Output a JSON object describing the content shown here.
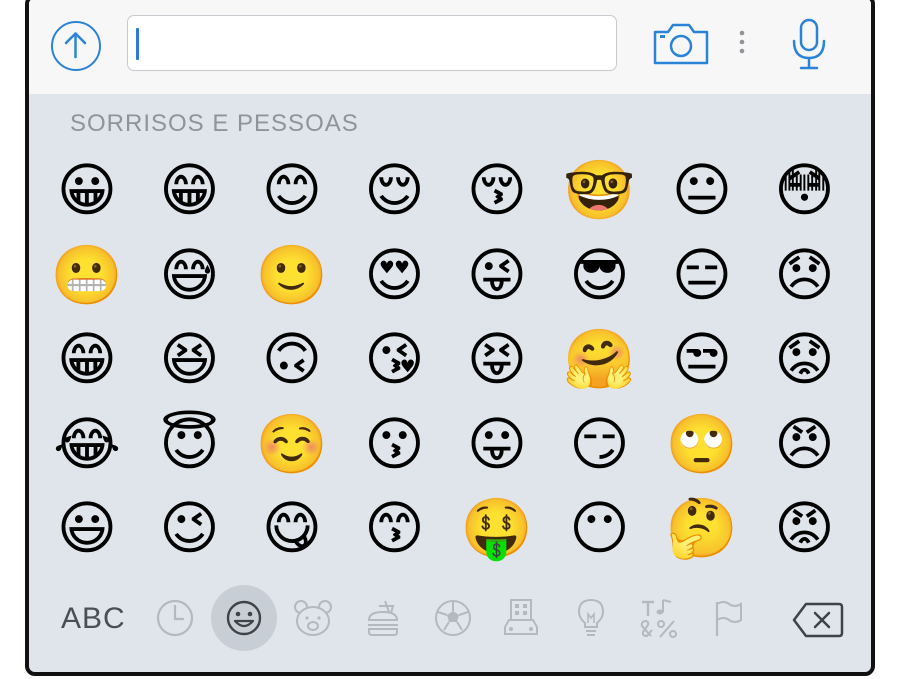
{
  "section_title": "SORRISOS E PESSOAS",
  "emoji_rows": [
    [
      "😀",
      "😁",
      "😊",
      "😌",
      "😚",
      "🤓",
      "😐",
      "😳"
    ],
    [
      "😬",
      "😅",
      "🙂",
      "😍",
      "😜",
      "😎",
      "😑",
      "😞"
    ],
    [
      "😁",
      "😆",
      "🙃",
      "😘",
      "😝",
      "🤗",
      "😒",
      "😟"
    ],
    [
      "😂",
      "😇",
      "☺️",
      "😗",
      "😛",
      "😏",
      "🙄",
      "😠"
    ],
    [
      "😃",
      "😉",
      "😋",
      "😙",
      "🤑",
      "😶",
      "🤔",
      "😡"
    ]
  ],
  "keyboard": {
    "abc_label": "ABC",
    "categories": [
      "recent-icon",
      "smileys-icon",
      "animals-icon",
      "food-icon",
      "activity-icon",
      "travel-icon",
      "objects-icon",
      "symbols-icon",
      "flags-icon"
    ],
    "selected_category": "smileys-icon"
  },
  "colors": {
    "accent": "#2b83d8",
    "panel": "#dfe5ea",
    "category_gray": "#b3b9bf"
  }
}
